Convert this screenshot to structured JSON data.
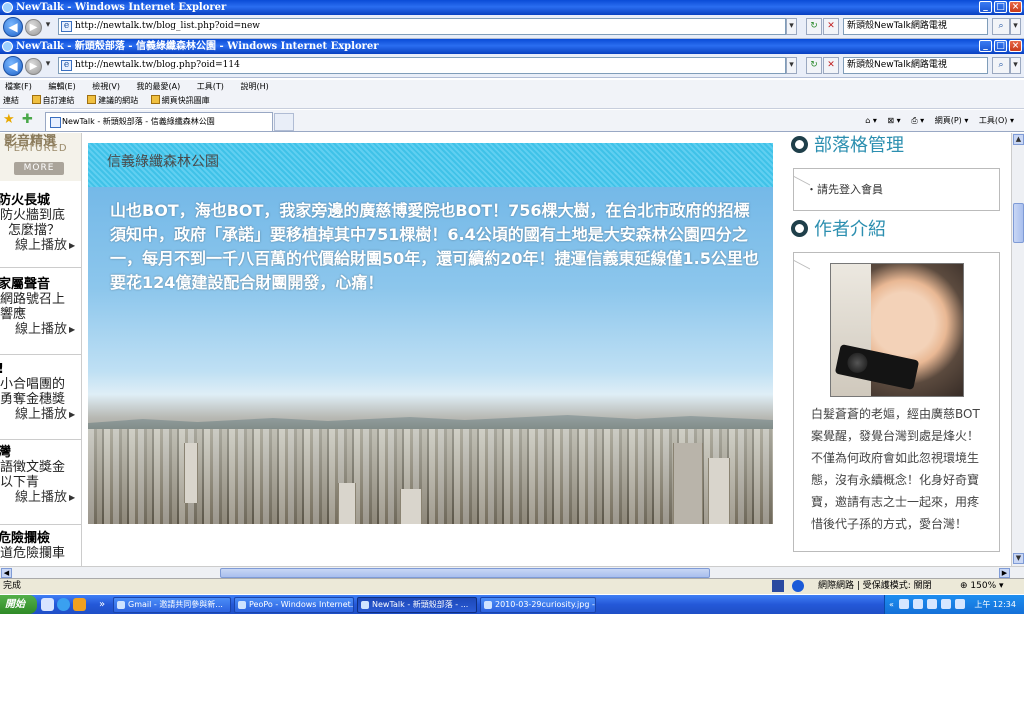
{
  "windows": [
    {
      "title": "NewTalk - Windows Internet Explorer",
      "address": "http://newtalk.tw/blog_list.php?oid=new",
      "search": "新頭殼NewTalk網路電視"
    },
    {
      "title": "NewTalk - 新頭殼部落 - 信義綠纖森林公園 - Windows Internet Explorer",
      "address": "http://newtalk.tw/blog.php?oid=114",
      "search": "新頭殼NewTalk網路電視"
    }
  ],
  "window_buttons": {
    "min": "_",
    "max": "□",
    "close": "×"
  },
  "nav": {
    "back": "◀",
    "forward": "▶",
    "refresh": "↻",
    "stop": "✕",
    "dropdown": "▾",
    "search_go": "⌕"
  },
  "menu": [
    "檔案(F)",
    "編輯(E)",
    "檢視(V)",
    "我的最愛(A)",
    "工具(T)",
    "說明(H)"
  ],
  "links_bar": {
    "label": "連結",
    "items": [
      "自訂連結",
      "建議的網站",
      "網頁快訊圖庫"
    ]
  },
  "tab": {
    "label": "NewTalk - 新頭殼部落 - 信義綠纖森林公園"
  },
  "commands": [
    "⌂ ▾",
    "⊠ ▾",
    "⎙ ▾",
    "網頁(P) ▾",
    "工具(O) ▾"
  ],
  "featured": {
    "title": "影音精選",
    "subtitle": "FEATURED",
    "more": "MORE"
  },
  "news": [
    {
      "headline": "防火長城",
      "lines": [
        "防火牆到底",
        "怎麼擋？"
      ],
      "play": "線上播放"
    },
    {
      "headline": "家屬聲音",
      "lines": [
        "網路號召上",
        "響應"
      ],
      "play": "線上播放"
    },
    {
      "headline": "!",
      "lines": [
        "小合唱團的",
        "勇奪金穗獎"
      ],
      "play": "線上播放"
    },
    {
      "headline": "灣",
      "lines": [
        "語徵文獎金",
        "以下青"
      ],
      "play": "線上播放"
    },
    {
      "headline": "危險攔檢",
      "lines": [
        "道危險攔車"
      ],
      "play": ""
    }
  ],
  "post": {
    "title": "信義綠纖森林公園",
    "body": "山也BOT，海也BOT，我家旁邊的廣慈博愛院也BOT！756棵大樹，在台北市政府的招標須知中，政府「承諾」要移植掉其中751棵樹！6.4公頃的國有土地是大安森林公園四分之一，每月不到一千八百萬的代價給財團50年，還可續約20年！捷運信義東延線僅1.5公里也要花124億建設配合財團開發，心痛！"
  },
  "sidebar": {
    "manage_title": "部落格管理",
    "login_text": "・請先登入會員",
    "author_title": "作者介紹",
    "bio": "白髮蒼蒼的老嫗，經由廣慈BOT案覺醒，發覺台灣到處是烽火！不僅為何政府會如此忽視環境生態，沒有永續概念！化身好奇寶寶，邀請有志之士一起來，用疼惜後代子孫的方式，愛台灣！"
  },
  "status": {
    "left": "完成",
    "mode": "網際網路 | 受保護模式: 關閉",
    "zoom": "150%"
  },
  "taskbar": {
    "start": "開始",
    "quicklaunch_more": "»",
    "tasks": [
      "Gmail - 邀請共同參與新...",
      "PeoPo - Windows Internet...",
      "NewTalk - 新頭殼部落 - ...",
      "2010-03-29curiosity.jpg - ..."
    ],
    "tray_more": "«",
    "clock": "上午 12:34"
  },
  "colors": {
    "accent": "#2c8fb0",
    "header_band": "#3ac3e8",
    "ie_title": "#0a4bd6"
  }
}
